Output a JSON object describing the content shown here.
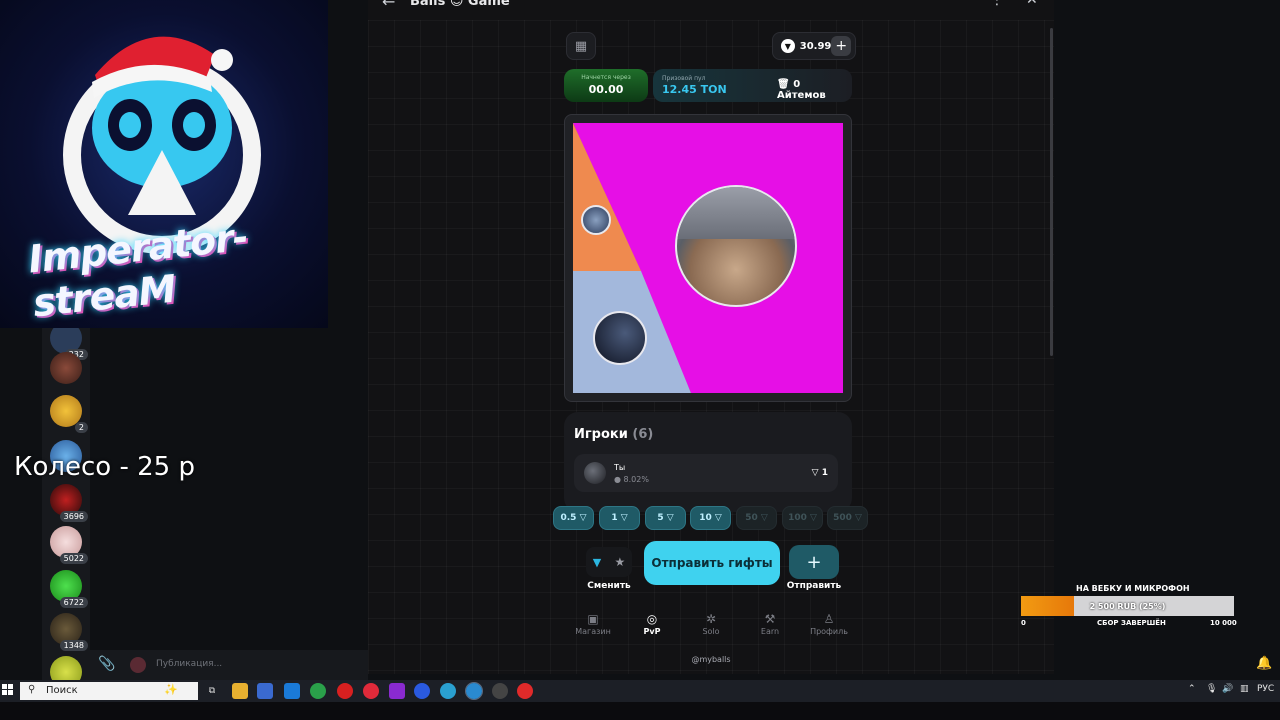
{
  "window": {
    "title": "Balls 😊 Game",
    "back_icon": "arrow-left-icon",
    "more_icon": "more-vertical-icon",
    "close_icon": "close-icon"
  },
  "game": {
    "balance": "30.99",
    "starts_label": "Начнется через",
    "starts_value": "00.00",
    "pool_label": "Призовой пул",
    "pool_value": "12.45 TON",
    "items_label": "0 Айтемов",
    "colors": {
      "magenta": "#e60fe6",
      "orange": "#ef8a4f",
      "blue": "#a3b8dc"
    }
  },
  "players": {
    "title": "Игроки",
    "count": "(6)",
    "rows": [
      {
        "name": "Ты",
        "percent": "8.02%",
        "bet": "1"
      }
    ]
  },
  "bets": [
    "0.5",
    "1",
    "5",
    "10",
    "50",
    "100",
    "500"
  ],
  "actions": {
    "swap_label": "Сменить",
    "send_gifts_label": "Отправить гифты",
    "send_label": "Отправить"
  },
  "nav": [
    {
      "label": "Магазин",
      "icon": "shop-icon"
    },
    {
      "label": "PvP",
      "icon": "pvp-icon"
    },
    {
      "label": "Solo",
      "icon": "solo-icon"
    },
    {
      "label": "Earn",
      "icon": "earn-icon"
    },
    {
      "label": "Профиль",
      "icon": "profile-icon"
    }
  ],
  "handle": "@myballs",
  "overlay": {
    "logo_text": "Imperator-streaM",
    "wheel_text": "Колесо - 25 р"
  },
  "chat": {
    "badges": [
      "232",
      "2",
      "3696",
      "5022",
      "6722",
      "1348"
    ],
    "input_placeholder": "Публикация..."
  },
  "goal": {
    "title": "НА ВЕБКУ И МИКРОФОН",
    "progress_text": "2 500 RUB (25%)",
    "progress": 0.25,
    "min": "0",
    "status": "СБОР ЗАВЕРШЁН",
    "max": "10 000"
  },
  "taskbar": {
    "search_text": "Поиск",
    "language": "РУС"
  }
}
